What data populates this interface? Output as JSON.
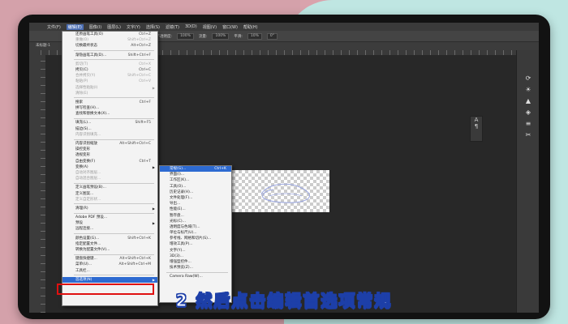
{
  "menubar": {
    "items": [
      "文件(F)",
      "编辑(E)",
      "图像(I)",
      "图层(L)",
      "文字(Y)",
      "选择(S)",
      "滤镜(T)",
      "3D(D)",
      "视图(V)",
      "窗口(W)",
      "帮助(H)"
    ]
  },
  "optionsbar": {
    "items": [
      "模式:",
      "不透明度:",
      "100%",
      "流量:",
      "100%",
      "平滑:",
      "10%",
      "0°"
    ]
  },
  "tab": {
    "label": "未标题-1"
  },
  "edit_menu": {
    "items": [
      {
        "label": "还原画笔工具(O)",
        "shortcut": "Ctrl+Z",
        "disabled": false
      },
      {
        "label": "重做(O)",
        "shortcut": "Shift+Ctrl+Z",
        "disabled": true
      },
      {
        "label": "切换最终状态",
        "shortcut": "Alt+Ctrl+Z",
        "disabled": false
      },
      {
        "sep": true
      },
      {
        "label": "渐隐画笔工具(D)...",
        "shortcut": "Shift+Ctrl+F",
        "disabled": false
      },
      {
        "sep": true
      },
      {
        "label": "剪切(T)",
        "shortcut": "Ctrl+X",
        "disabled": true
      },
      {
        "label": "拷贝(C)",
        "shortcut": "Ctrl+C",
        "disabled": false
      },
      {
        "label": "合并拷贝(Y)",
        "shortcut": "Shift+Ctrl+C",
        "disabled": true
      },
      {
        "label": "粘贴(P)",
        "shortcut": "Ctrl+V",
        "disabled": true
      },
      {
        "label": "选择性粘贴(I)",
        "shortcut": "",
        "disabled": true,
        "arrow": true
      },
      {
        "label": "清除(E)",
        "shortcut": "",
        "disabled": true
      },
      {
        "sep": true
      },
      {
        "label": "搜索",
        "shortcut": "Ctrl+F",
        "disabled": false
      },
      {
        "label": "拼写检查(H)...",
        "shortcut": "",
        "disabled": false
      },
      {
        "label": "查找和替换文本(X)...",
        "shortcut": "",
        "disabled": false
      },
      {
        "sep": true
      },
      {
        "label": "填充(L)...",
        "shortcut": "Shift+F5",
        "disabled": false
      },
      {
        "label": "描边(S)...",
        "shortcut": "",
        "disabled": false
      },
      {
        "label": "内容识别填充...",
        "shortcut": "",
        "disabled": true
      },
      {
        "sep": true
      },
      {
        "label": "内容识别缩放",
        "shortcut": "Alt+Shift+Ctrl+C",
        "disabled": false
      },
      {
        "label": "操控变形",
        "shortcut": "",
        "disabled": false
      },
      {
        "label": "透视变形",
        "shortcut": "",
        "disabled": false
      },
      {
        "label": "自由变换(F)",
        "shortcut": "Ctrl+T",
        "disabled": false
      },
      {
        "label": "变换(A)",
        "shortcut": "",
        "disabled": false,
        "arrow": true
      },
      {
        "label": "自动对齐图层...",
        "shortcut": "",
        "disabled": true
      },
      {
        "label": "自动混合图层...",
        "shortcut": "",
        "disabled": true
      },
      {
        "sep": true
      },
      {
        "label": "定义画笔预设(B)...",
        "shortcut": "",
        "disabled": false
      },
      {
        "label": "定义图案...",
        "shortcut": "",
        "disabled": false
      },
      {
        "label": "定义自定形状...",
        "shortcut": "",
        "disabled": true
      },
      {
        "sep": true
      },
      {
        "label": "清理(R)",
        "shortcut": "",
        "disabled": false,
        "arrow": true
      },
      {
        "sep": true
      },
      {
        "label": "Adobe PDF 预设...",
        "shortcut": "",
        "disabled": false
      },
      {
        "label": "预设",
        "shortcut": "",
        "disabled": false,
        "arrow": true
      },
      {
        "label": "远程连接...",
        "shortcut": "",
        "disabled": false
      },
      {
        "sep": true
      },
      {
        "label": "颜色设置(G)...",
        "shortcut": "Shift+Ctrl+K",
        "disabled": false
      },
      {
        "label": "指定配置文件...",
        "shortcut": "",
        "disabled": false
      },
      {
        "label": "转换为配置文件(V)...",
        "shortcut": "",
        "disabled": false
      },
      {
        "sep": true
      },
      {
        "label": "键盘快捷键...",
        "shortcut": "Alt+Shift+Ctrl+K",
        "disabled": false
      },
      {
        "label": "菜单(U)...",
        "shortcut": "Alt+Shift+Ctrl+M",
        "disabled": false
      },
      {
        "label": "工具栏...",
        "shortcut": "",
        "disabled": false
      },
      {
        "sep": true
      },
      {
        "label": "首选项(N)",
        "shortcut": "",
        "disabled": false,
        "arrow": true,
        "highlight": true
      }
    ]
  },
  "submenu": {
    "items": [
      {
        "label": "常规(G)...",
        "shortcut": "Ctrl+K",
        "highlight": true
      },
      {
        "label": "界面(I)..."
      },
      {
        "label": "工作区(K)..."
      },
      {
        "label": "工具(O)..."
      },
      {
        "label": "历史记录(H)..."
      },
      {
        "label": "文件处理(F)..."
      },
      {
        "label": "导出..."
      },
      {
        "label": "性能(E)..."
      },
      {
        "label": "暂存盘..."
      },
      {
        "label": "光标(C)..."
      },
      {
        "label": "透明度与色域(T)..."
      },
      {
        "label": "单位与标尺(U)..."
      },
      {
        "label": "参考线、网格和切片(S)..."
      },
      {
        "label": "增效工具(P)..."
      },
      {
        "label": "文字(Y)..."
      },
      {
        "label": "3D(3)..."
      },
      {
        "label": "增强型控件..."
      },
      {
        "label": "技术预览(Z)..."
      },
      {
        "sep": true
      },
      {
        "label": "Camera Raw(W)..."
      }
    ]
  },
  "caption": {
    "text": "2 然后点击编辑首选项常规"
  },
  "colors": {
    "accent": "#2d6ad1",
    "highlight_box": "#e01010",
    "caption_stroke": "#1d3fa8"
  }
}
